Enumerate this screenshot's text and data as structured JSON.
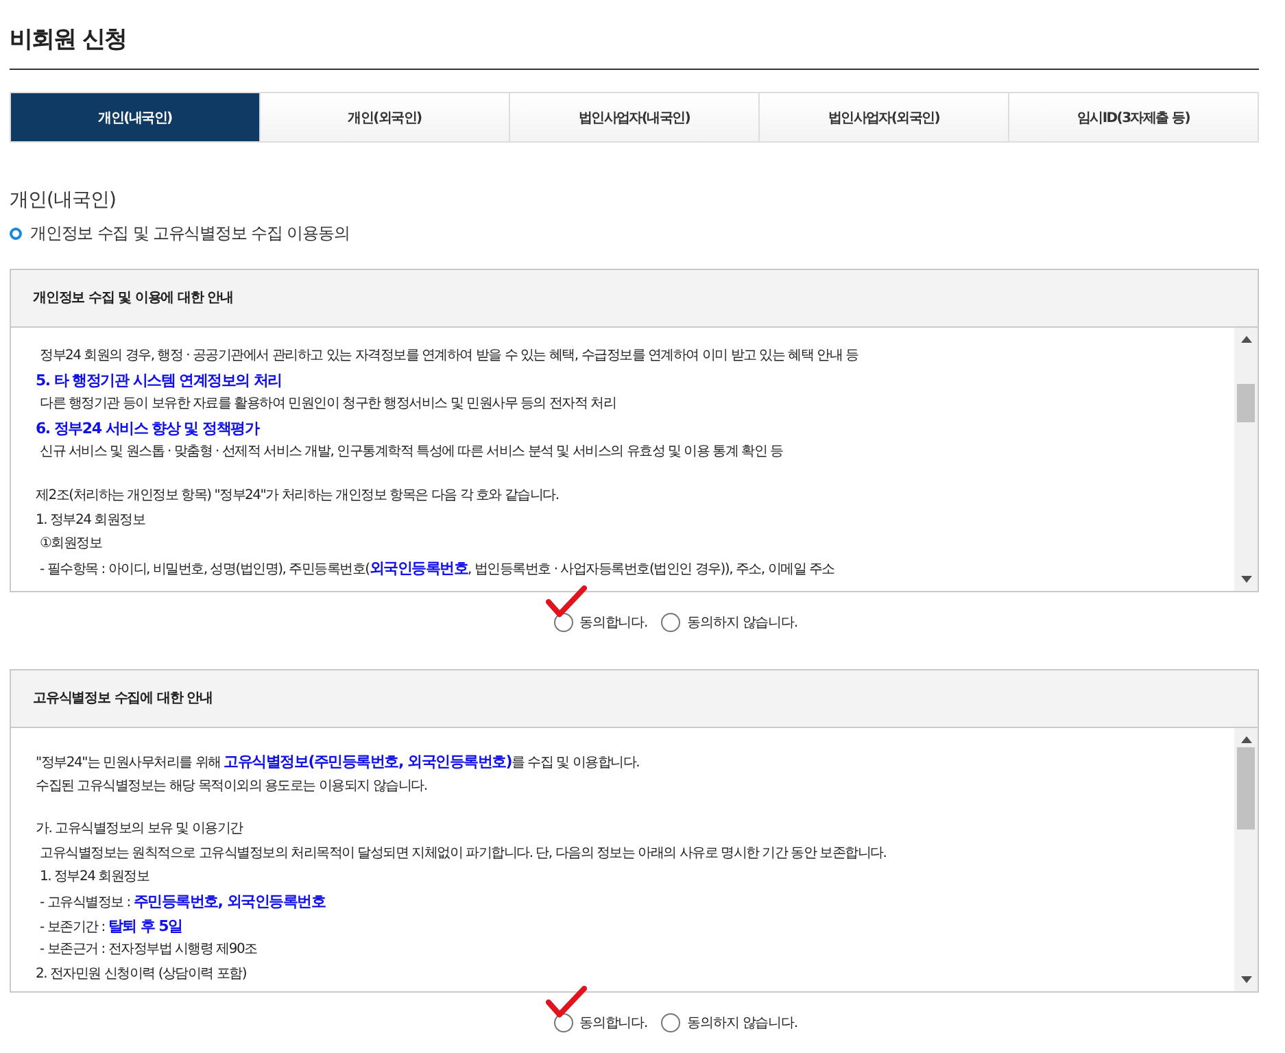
{
  "page_title": "비회원 신청",
  "tabs": [
    {
      "label": "개인(내국인)",
      "selected": true
    },
    {
      "label": "개인(외국인)",
      "selected": false
    },
    {
      "label": "법인사업자(내국인)",
      "selected": false
    },
    {
      "label": "법인사업자(외국인)",
      "selected": false
    },
    {
      "label": "임시ID(3자제출 등)",
      "selected": false
    }
  ],
  "section_title": "개인(내국인)",
  "subtitle": "개인정보 수집 및 고유식별정보 수집 이용동의",
  "panels": [
    {
      "header": "개인정보 수집 및 이용에 대한 안내",
      "lines": [
        {
          "kind": "text",
          "text": "정부24 회원의 경우, 행정 · 공공기관에서 관리하고 있는 자격정보를 연계하여 받을 수 있는 혜택, 수급정보를 연계하여 이미 받고 있는 혜택 안내 등"
        },
        {
          "kind": "heading",
          "text": "5. 타 행정기관 시스템 연계정보의 처리"
        },
        {
          "kind": "text",
          "text": "다른 행정기관 등이 보유한 자료를 활용하여 민원인이 청구한 행정서비스 및 민원사무 등의 전자적 처리"
        },
        {
          "kind": "heading",
          "text": "6. 정부24 서비스 향상 및 정책평가"
        },
        {
          "kind": "text",
          "text": "신규 서비스 및 원스톱 · 맞춤형 · 선제적 서비스 개발, 인구통계학적 특성에 따른 서비스 분석 및 서비스의 유효성 및 이용 통계 확인 등"
        },
        {
          "kind": "blank"
        },
        {
          "kind": "plain",
          "text": "제2조(처리하는 개인정보 항목) \"정부24\"가 처리하는 개인정보 항목은 다음 각 호와 같습니다."
        },
        {
          "kind": "plain",
          "text": "1. 정부24 회원정보"
        },
        {
          "kind": "text",
          "text": "①회원정보"
        },
        {
          "kind": "text",
          "text": "- 필수항목 : 아이디, 비밀번호, 성명(법인명), 주민등록번호(**외국인등록번호**, 법인등록번호 · 사업자등록번호(법인인 경우)), 주소, 이메일 주소"
        }
      ],
      "options": [
        {
          "label": "동의합니다.",
          "selected": false,
          "marked": true
        },
        {
          "label": "동의하지 않습니다.",
          "selected": false,
          "marked": false
        }
      ]
    },
    {
      "header": "고유식별정보 수집에 대한 안내",
      "lines": [
        {
          "kind": "plain",
          "text": "\"정부24\"는 민원사무처리를 위해 **고유식별정보(주민등록번호, 외국인등록번호)**를 수집 및 이용합니다."
        },
        {
          "kind": "plain",
          "text": "수집된 고유식별정보는 해당 목적이외의 용도로는 이용되지 않습니다."
        },
        {
          "kind": "blank"
        },
        {
          "kind": "plain",
          "text": "가. 고유식별정보의 보유 및 이용기간"
        },
        {
          "kind": "text",
          "text": "고유식별정보는 원칙적으로 고유식별정보의 처리목적이 달성되면 지체없이 파기합니다. 단, 다음의 정보는 아래의 사유로 명시한 기간 동안 보존합니다."
        },
        {
          "kind": "text",
          "text": "1. 정부24 회원정보"
        },
        {
          "kind": "text",
          "text": "- 고유식별정보 : **주민등록번호, 외국인등록번호**"
        },
        {
          "kind": "text",
          "text": "- 보존기간 : **탈퇴 후 5일**"
        },
        {
          "kind": "text",
          "text": "- 보존근거 : 전자정부법 시행령 제90조"
        },
        {
          "kind": "plain",
          "text": "2. 전자민원 신청이력 (상담이력 포함)"
        }
      ],
      "options": [
        {
          "label": "동의합니다.",
          "selected": false,
          "marked": true
        },
        {
          "label": "동의하지 않습니다.",
          "selected": false,
          "marked": false
        }
      ]
    }
  ]
}
